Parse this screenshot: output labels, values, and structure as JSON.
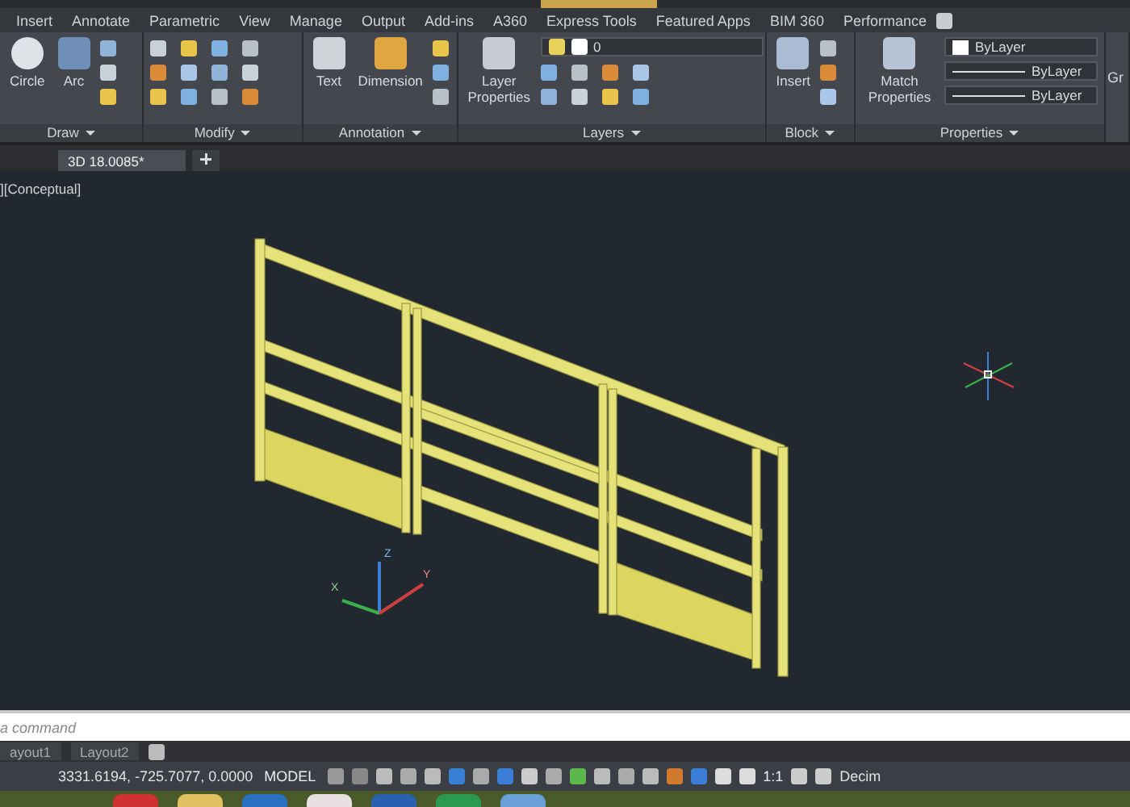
{
  "ribbon": {
    "tabs": [
      {
        "label": "Insert",
        "selected": false
      },
      {
        "label": "Annotate",
        "selected": false
      },
      {
        "label": "Parametric",
        "selected": false
      },
      {
        "label": "View",
        "selected": false
      },
      {
        "label": "Manage",
        "selected": false
      },
      {
        "label": "Output",
        "selected": false
      },
      {
        "label": "Add-ins",
        "selected": false
      },
      {
        "label": "A360",
        "selected": false
      },
      {
        "label": "Express Tools",
        "selected": false
      },
      {
        "label": "Featured Apps",
        "selected": false
      },
      {
        "label": "BIM 360",
        "selected": false
      },
      {
        "label": "Performance",
        "selected": false
      }
    ],
    "panels": [
      {
        "kind": "draw",
        "title": "Draw",
        "tools": [
          "Circle",
          "Arc"
        ]
      },
      {
        "kind": "modify",
        "title": "Modify"
      },
      {
        "kind": "annotation",
        "title": "Annotation",
        "tools": [
          "Text",
          "Dimension"
        ]
      },
      {
        "kind": "layers",
        "title": "Layers",
        "tools": [
          "Layer Properties"
        ],
        "layer": "0"
      },
      {
        "kind": "block",
        "title": "Block",
        "tools": [
          "Insert"
        ]
      },
      {
        "kind": "properties",
        "title": "Properties",
        "tools": [
          "Match Properties"
        ],
        "dropdowns": [
          "ByLayer",
          "ByLayer",
          "ByLayer"
        ]
      },
      {
        "kind": "cut",
        "title": "Gr"
      }
    ]
  },
  "document_tabs": [
    {
      "label": "3D 18.0085*",
      "selected": true
    }
  ],
  "viewport": {
    "label": "][Conceptual]",
    "axis_labels": [
      "X",
      "Y",
      "Z"
    ]
  },
  "command_line": {
    "placeholder": "a command"
  },
  "layout_tabs": [
    {
      "label": "ayout1",
      "selected": false
    },
    {
      "label": "Layout2",
      "selected": false
    }
  ],
  "status_bar": {
    "coordinates": "3331.6194, -725.7077, 0.0000",
    "space": "MODEL",
    "scale": "1:1",
    "units": "Decim"
  }
}
